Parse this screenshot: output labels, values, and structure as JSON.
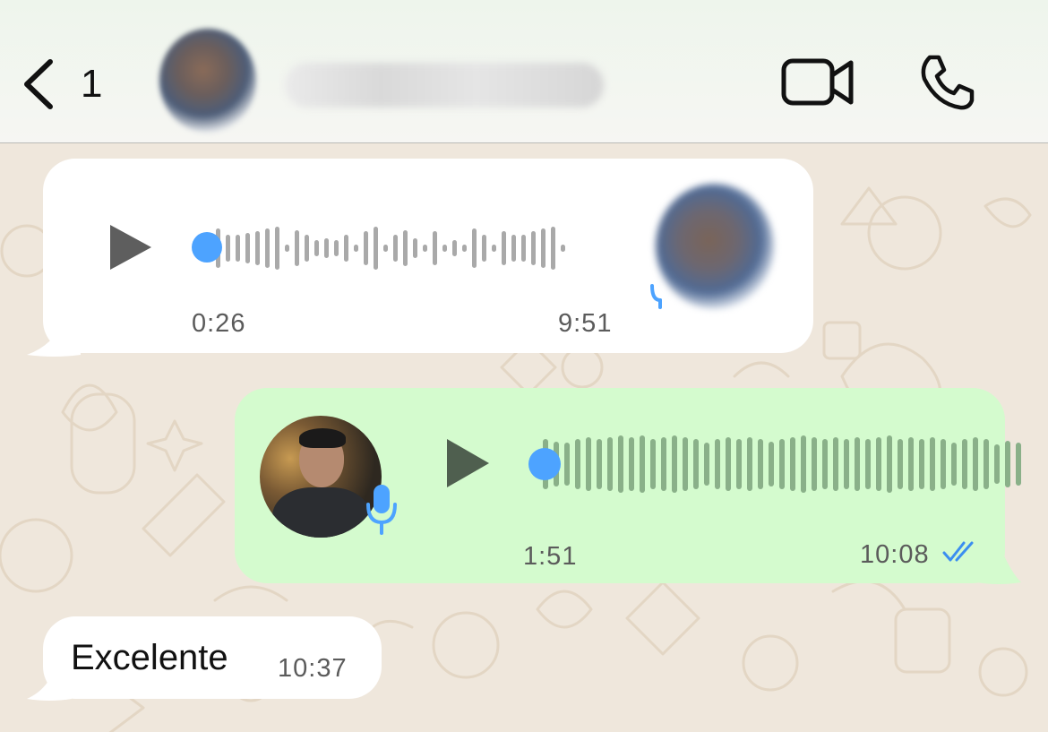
{
  "header": {
    "back_count": "1",
    "icons": {
      "back": "chevron-left-icon",
      "video": "video-camera-icon",
      "call": "phone-icon"
    }
  },
  "messages": [
    {
      "type": "voice",
      "direction": "incoming",
      "elapsed": "0:26",
      "time": "9:51",
      "progress": 0.0,
      "icons": {
        "play": "play-icon",
        "mic": "mic-icon"
      }
    },
    {
      "type": "voice",
      "direction": "outgoing",
      "duration": "1:51",
      "time": "10:08",
      "progress": 0.0,
      "read": true,
      "icons": {
        "play": "play-icon",
        "mic": "mic-icon",
        "status": "double-check-icon"
      }
    },
    {
      "type": "text",
      "direction": "incoming",
      "text": "Excelente",
      "time": "10:37"
    }
  ],
  "colors": {
    "outgoing_bubble": "#d4fbce",
    "incoming_bubble": "#ffffff",
    "wallpaper": "#efe7dc",
    "accent_blue": "#4da3ff"
  }
}
